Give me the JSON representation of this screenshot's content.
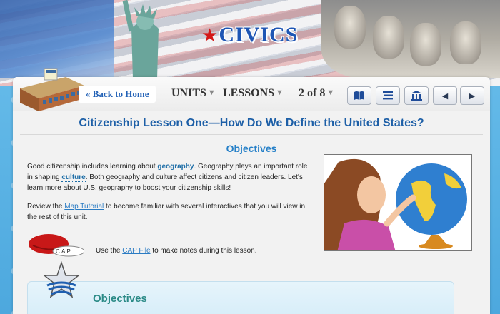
{
  "brand": {
    "logo_text": "CIVICS"
  },
  "nav": {
    "back_home": "« Back to Home",
    "units": "UNITS",
    "lessons": "LESSONS",
    "page_indicator": "2 of 8",
    "icons": [
      "book-icon",
      "list-icon",
      "building-icon",
      "prev-arrow-icon",
      "next-arrow-icon"
    ]
  },
  "lesson": {
    "title": "Citizenship Lesson One—How Do We Define the United States?",
    "subheading": "Objectives",
    "p1_a": "Good citizenship includes learning about ",
    "p1_kw1": "geography",
    "p1_b": ". Geography plays an important role in shaping ",
    "p1_kw2": "culture",
    "p1_c": ". Both geography and culture affect citizens and citizen leaders. Let's learn more about U.S. geography to boost your citizenship skills!",
    "p2_a": "Review the ",
    "p2_link": "Map Tutorial",
    "p2_b": " to become familiar with several interactives that you will view in the rest of this unit.",
    "cap_label": "C.A.P.",
    "cap_a": "Use the ",
    "cap_link": "CAP File",
    "cap_b": " to make notes during this lesson."
  },
  "objectives_box": {
    "title": "Objectives"
  },
  "colors": {
    "title_blue": "#1d5fa7",
    "link_blue": "#2a7bc3",
    "logo_blue": "#1f56b4",
    "star_red": "#d41818",
    "teal": "#2a8a86"
  }
}
